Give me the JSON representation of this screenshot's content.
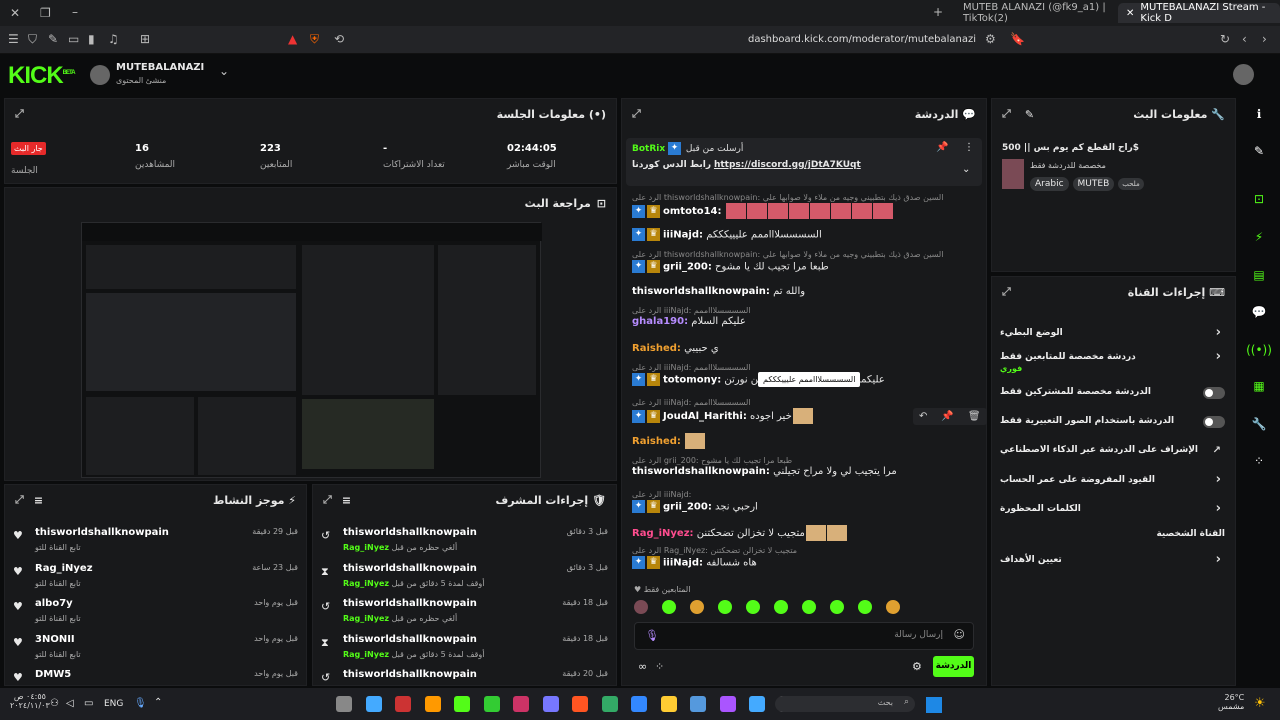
{
  "browser": {
    "tabs": [
      {
        "label": "MUTEB ALANAZI (@fk9_a1) | TikTok(2)"
      },
      {
        "label": "MUTEBALANAZI Stream - Kick D"
      }
    ],
    "url": "dashboard.kick.com/moderator/mutebalanazi"
  },
  "header": {
    "logo": "KICK",
    "logo_badge": "BETA",
    "channel_name": "MUTEBALANAZI",
    "channel_role": "منشئ المحتوى"
  },
  "session": {
    "title": "معلومات الجلسة",
    "live_badge": "جار البث",
    "live_label": "الجلسة",
    "viewers_value": "16",
    "viewers_label": "المشاهدين",
    "followers_value": "223",
    "followers_label": "المتابعين",
    "subs_value": "-",
    "subs_label": "تعداد الاشتراكات",
    "live_time_value": "02:44:05",
    "live_time_label": "الوقت مباشر"
  },
  "preview": {
    "title": "مراجعة البث"
  },
  "activity": {
    "title": "موجز النشاط",
    "items": [
      {
        "name": "thisworldshallknowpain",
        "sub": "تابع القناة للتو",
        "time": "قبل 29 دقيقة"
      },
      {
        "name": "Rag_iNyez",
        "sub": "تابع القناة للتو",
        "time": "قبل 23 ساعة"
      },
      {
        "name": "albo7y",
        "sub": "تابع القناة للتو",
        "time": "قبل يوم واحد"
      },
      {
        "name": "3NONII",
        "sub": "تابع القناة للتو",
        "time": "قبل يوم واحد"
      },
      {
        "name": "DMW5",
        "sub": "",
        "time": "قبل يوم واحد"
      }
    ]
  },
  "mod_actions": {
    "title": "إجراءات المشرف",
    "items": [
      {
        "name": "thisworldshallknowpain",
        "sub": "ألغي حظره من قبل",
        "by": "Rag_iNyez",
        "time": "قبل 3 دقائق"
      },
      {
        "name": "thisworldshallknowpain",
        "sub": "أوقف لمدة 5 دقائق من قبل",
        "by": "Rag_iNyez",
        "time": "قبل 3 دقائق"
      },
      {
        "name": "thisworldshallknowpain",
        "sub": "ألغي حظره من قبل",
        "by": "Rag_iNyez",
        "time": "قبل 18 دقيقة"
      },
      {
        "name": "thisworldshallknowpain",
        "sub": "أوقف لمدة 5 دقائق من قبل",
        "by": "Rag_iNyez",
        "time": "قبل 18 دقيقة"
      },
      {
        "name": "thisworldshallknowpain",
        "sub": "",
        "by": "",
        "time": "قبل 20 دقيقة"
      }
    ]
  },
  "chat": {
    "title": "الدردشة",
    "pinned_by": "أرسلت من قبل",
    "pinned_user": "BotRix",
    "pinned_text": "رابط الدس كوردنا",
    "pinned_link": "https://discord.gg/jDtA7KUqt",
    "messages": [
      {
        "reply": "الرد على thisworldshallknowpain: السين صدق ذيك بتطبيني وجيه من ملاء ولا صوابها علي",
        "user": "omtoto14:",
        "text": ""
      },
      {
        "reply": "",
        "user": "iiiNajd:",
        "text": "السسسسلاااممم عليييكككم"
      },
      {
        "reply": "الرد على thisworldshallknowpain: السين صدق ذيك بتطبيني وجيه من ملاء ولا صوابها علي",
        "user": "grii_200:",
        "text": "طبعا مرا تجيب لك يا مشوح"
      },
      {
        "reply": "",
        "user": "thisworldshallknowpain:",
        "text": "والله تم"
      },
      {
        "reply": "الرد على iiiNajd: السسسسلاااممم",
        "user": "ghala190:",
        "text": "عليكم السلام"
      },
      {
        "reply": "",
        "user": "Raished:",
        "text": "ي حبيبي"
      },
      {
        "reply": "الرد على iiiNajd: السسسسلاااممم",
        "user": "totomony:",
        "text": "عليكمممممممم السلاااام ارحبين نورتن"
      },
      {
        "reply": "الرد على iiiNajd: السسسسلاااممم",
        "user": "JoudAl_Harithi:",
        "text": "خير اجوده"
      },
      {
        "reply": "",
        "user": "Raished:",
        "text": ""
      },
      {
        "reply": "الرد على grii_200: طبعا مرا تجيب لك يا مشوح",
        "user": "thisworldshallknowpain:",
        "text": "مرا يتجيب لي ولا مراح تجيلني"
      },
      {
        "reply": "الرد على iiiNajd:",
        "user": "grii_200:",
        "text": "ارحبي نجد"
      },
      {
        "reply": "",
        "user": "Rag_iNyez:",
        "text": "متجيب لا تخزالن تضحكتنن"
      },
      {
        "reply": "الرد على Rag_iNyez: متجيب لا تخزالن تضحكتنن",
        "user": "iiiNajd:",
        "text": "هاه شسالفه"
      }
    ],
    "tooltip": "السسسسلاااممم عليييكككم",
    "followers_only": "المتابعين فقط",
    "input_placeholder": "إرسال رسالة",
    "send_label": "الدردشة"
  },
  "stream_info": {
    "title": "معلومات البث",
    "stream_title": "راح القطع كم يوم بس || 500$",
    "category": "مخصصة للدردشة فقط",
    "tags": [
      "Arabic",
      "MUTEB"
    ],
    "mature_tag": "ملحب"
  },
  "channel_actions": {
    "title": "إجراءات القناة",
    "items": [
      {
        "label": "الوضع البطيء",
        "extra": "",
        "control": "chevron"
      },
      {
        "label": "دردشة مخصصة للمتابعين فقط",
        "extra": "فوري",
        "control": "chevron"
      },
      {
        "label": "الدردشة مخصصة للمشتركين فقط",
        "extra": "",
        "control": "toggle"
      },
      {
        "label": "الدردشة باستخدام الصور التعبيرية فقط",
        "extra": "",
        "control": "toggle"
      },
      {
        "label": "الإشراف على الدردشة عبر الذكاء الاصطناعي",
        "extra": "",
        "control": "link"
      },
      {
        "label": "القيود المفروضة على عمر الحساب",
        "extra": "",
        "control": "chevron"
      },
      {
        "label": "الكلمات المحظورة",
        "extra": "",
        "control": "chevron"
      },
      {
        "label": "القناة الشخصية",
        "extra": "",
        "control": "none"
      },
      {
        "label": "تعيين الأهداف",
        "extra": "",
        "control": "chevron"
      }
    ]
  },
  "taskbar": {
    "lang": "ENG",
    "time": "٠٤:٥٥ ص",
    "date": "٢٠٢٤/١١/٠٣",
    "search_placeholder": "بحث",
    "weather_temp": "26°C",
    "weather_desc": "مشمس"
  },
  "colors": {
    "accent": "#53fc18",
    "panel": "#18191b",
    "live": "#e62a2a",
    "mod": "#2a7bd3",
    "raished": "#f0a030",
    "rag": "#ff4d8f",
    "ghala": "#b68cff"
  }
}
